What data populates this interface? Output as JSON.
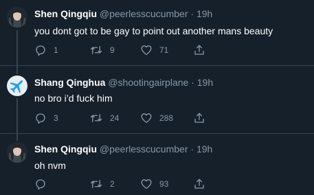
{
  "tweets": [
    {
      "name": "Shen Qingqiu",
      "handle": "@peerlesscucumber",
      "separator": "·",
      "time": "19h",
      "text": "you dont got to be gay to point out another mans beauty",
      "replies": "1",
      "retweets": "9",
      "likes": "71",
      "avatar": "anime-character"
    },
    {
      "name": "Shang Qinghua",
      "handle": "@shootingairplane",
      "separator": "·",
      "time": "19h",
      "text": "no bro i’d fuck him",
      "replies": "3",
      "retweets": "24",
      "likes": "288",
      "avatar": "airplane"
    },
    {
      "name": "Shen Qingqiu",
      "handle": "@peerlesscucumber",
      "separator": "·",
      "time": "19h",
      "text": "oh nvm",
      "replies": "",
      "retweets": "2",
      "likes": "93",
      "avatar": "anime-character"
    }
  ],
  "colors": {
    "background": "#15202b",
    "divider": "#38444d",
    "secondary_text": "#8899a6",
    "primary_text": "#ffffff",
    "airplane_avatar_bg": "#e8eef2",
    "airplane_icon": "#1da1f2"
  }
}
